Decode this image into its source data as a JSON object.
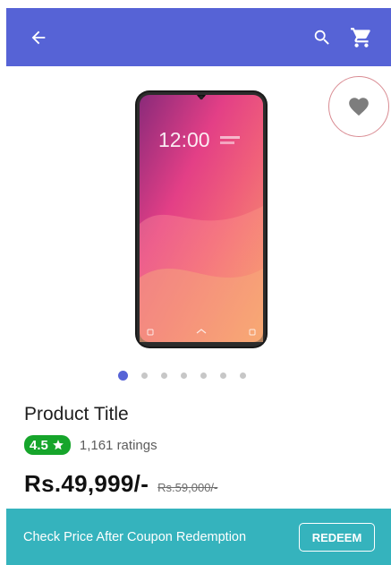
{
  "header": {
    "background": "#5663d6",
    "icons": [
      "back-arrow-icon",
      "search-icon",
      "cart-icon"
    ]
  },
  "favorite": {
    "icon": "heart-icon"
  },
  "product": {
    "image": "smartphone-product-image",
    "screen_time": "12:00",
    "carousel": {
      "count": 7,
      "active_index": 0
    },
    "title": "Product Title",
    "rating": "4.5",
    "ratings_count": "1,161 ratings",
    "price": "Rs.49,999/-",
    "mrp": "Rs.59,000/-"
  },
  "coupon_bar": {
    "text": "Check Price After Coupon Redemption",
    "button_label": "REDEEM",
    "background": "#35b3bd"
  },
  "colors": {
    "accent": "#5663d6",
    "rating_green": "#16a52b"
  }
}
